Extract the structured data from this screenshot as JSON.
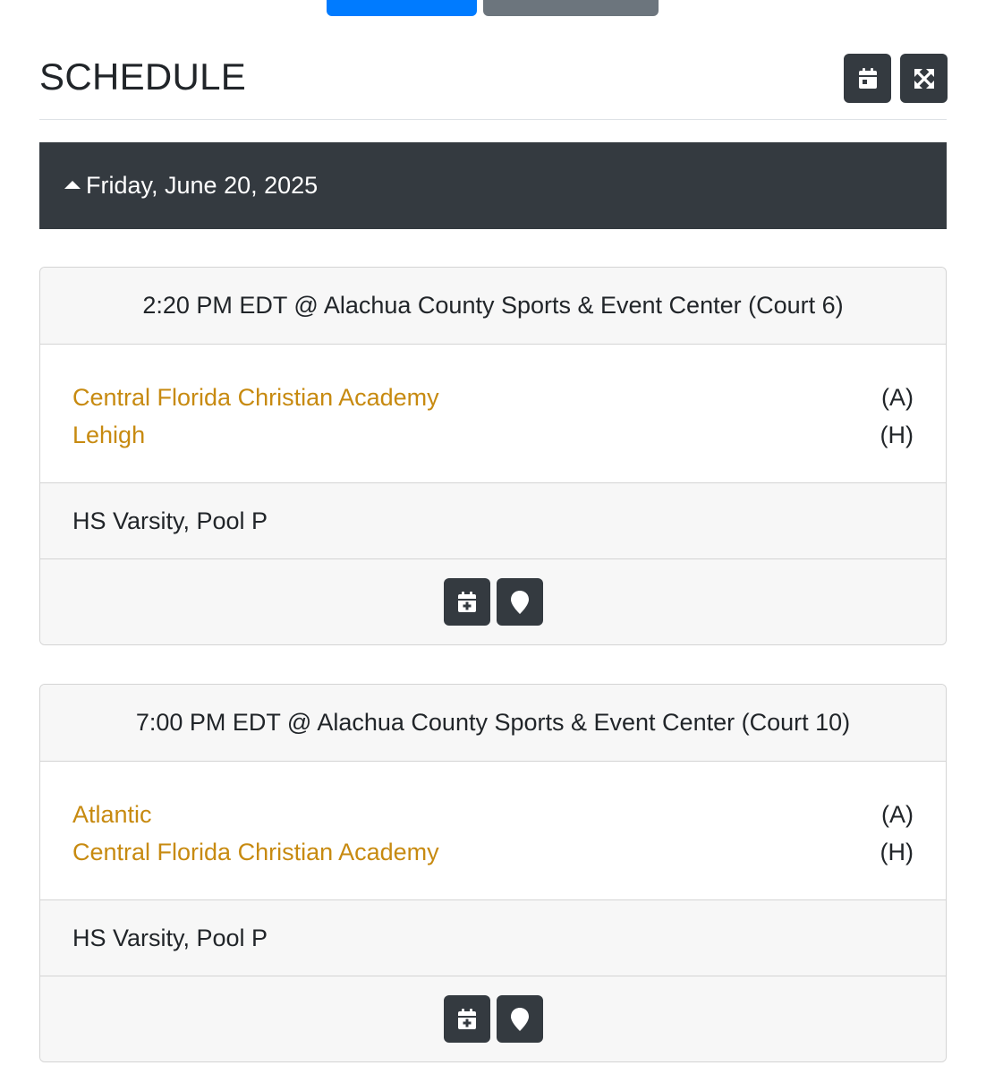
{
  "header": {
    "title": "SCHEDULE",
    "icons": [
      "calendar-icon",
      "expand-icon"
    ]
  },
  "day": {
    "date": "Friday, June 20, 2025",
    "icon": "caret-up-icon"
  },
  "colors": {
    "dark": "#343a40",
    "team_link": "#c78a10",
    "primary": "#007bff",
    "secondary": "#6c757d"
  },
  "games": [
    {
      "time_location": "2:20 PM EDT @ Alachua County Sports & Event Center (Court 6)",
      "teams": [
        {
          "name": "Central Florida Christian Academy",
          "side": "(A)"
        },
        {
          "name": "Lehigh",
          "side": "(H)"
        }
      ],
      "division": "HS Varsity, Pool P",
      "actions": [
        "calendar-plus-icon",
        "map-marker-icon"
      ]
    },
    {
      "time_location": "7:00 PM EDT @ Alachua County Sports & Event Center (Court 10)",
      "teams": [
        {
          "name": "Atlantic",
          "side": "(A)"
        },
        {
          "name": "Central Florida Christian Academy",
          "side": "(H)"
        }
      ],
      "division": "HS Varsity, Pool P",
      "actions": [
        "calendar-plus-icon",
        "map-marker-icon"
      ]
    }
  ]
}
